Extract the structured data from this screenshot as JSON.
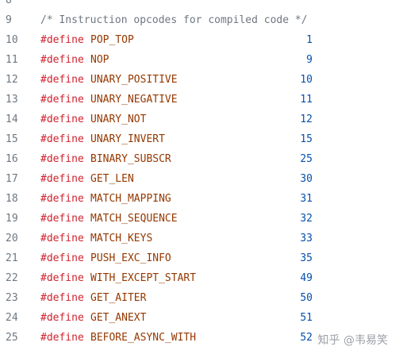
{
  "lines": [
    {
      "n": "8"
    },
    {
      "n": "9",
      "comment": "/* Instruction opcodes for compiled code */"
    },
    {
      "n": "10",
      "kw": "#define",
      "name": "POP_TOP",
      "val": "1"
    },
    {
      "n": "11",
      "kw": "#define",
      "name": "NOP",
      "val": "9"
    },
    {
      "n": "12",
      "kw": "#define",
      "name": "UNARY_POSITIVE",
      "val": "10"
    },
    {
      "n": "13",
      "kw": "#define",
      "name": "UNARY_NEGATIVE",
      "val": "11"
    },
    {
      "n": "14",
      "kw": "#define",
      "name": "UNARY_NOT",
      "val": "12"
    },
    {
      "n": "15",
      "kw": "#define",
      "name": "UNARY_INVERT",
      "val": "15"
    },
    {
      "n": "16",
      "kw": "#define",
      "name": "BINARY_SUBSCR",
      "val": "25"
    },
    {
      "n": "17",
      "kw": "#define",
      "name": "GET_LEN",
      "val": "30"
    },
    {
      "n": "18",
      "kw": "#define",
      "name": "MATCH_MAPPING",
      "val": "31"
    },
    {
      "n": "19",
      "kw": "#define",
      "name": "MATCH_SEQUENCE",
      "val": "32"
    },
    {
      "n": "20",
      "kw": "#define",
      "name": "MATCH_KEYS",
      "val": "33"
    },
    {
      "n": "21",
      "kw": "#define",
      "name": "PUSH_EXC_INFO",
      "val": "35"
    },
    {
      "n": "22",
      "kw": "#define",
      "name": "WITH_EXCEPT_START",
      "val": "49"
    },
    {
      "n": "23",
      "kw": "#define",
      "name": "GET_AITER",
      "val": "50"
    },
    {
      "n": "24",
      "kw": "#define",
      "name": "GET_ANEXT",
      "val": "51"
    },
    {
      "n": "25",
      "kw": "#define",
      "name": "BEFORE_ASYNC_WITH",
      "val": "52"
    }
  ],
  "watermark": "知乎 @韦易笑"
}
